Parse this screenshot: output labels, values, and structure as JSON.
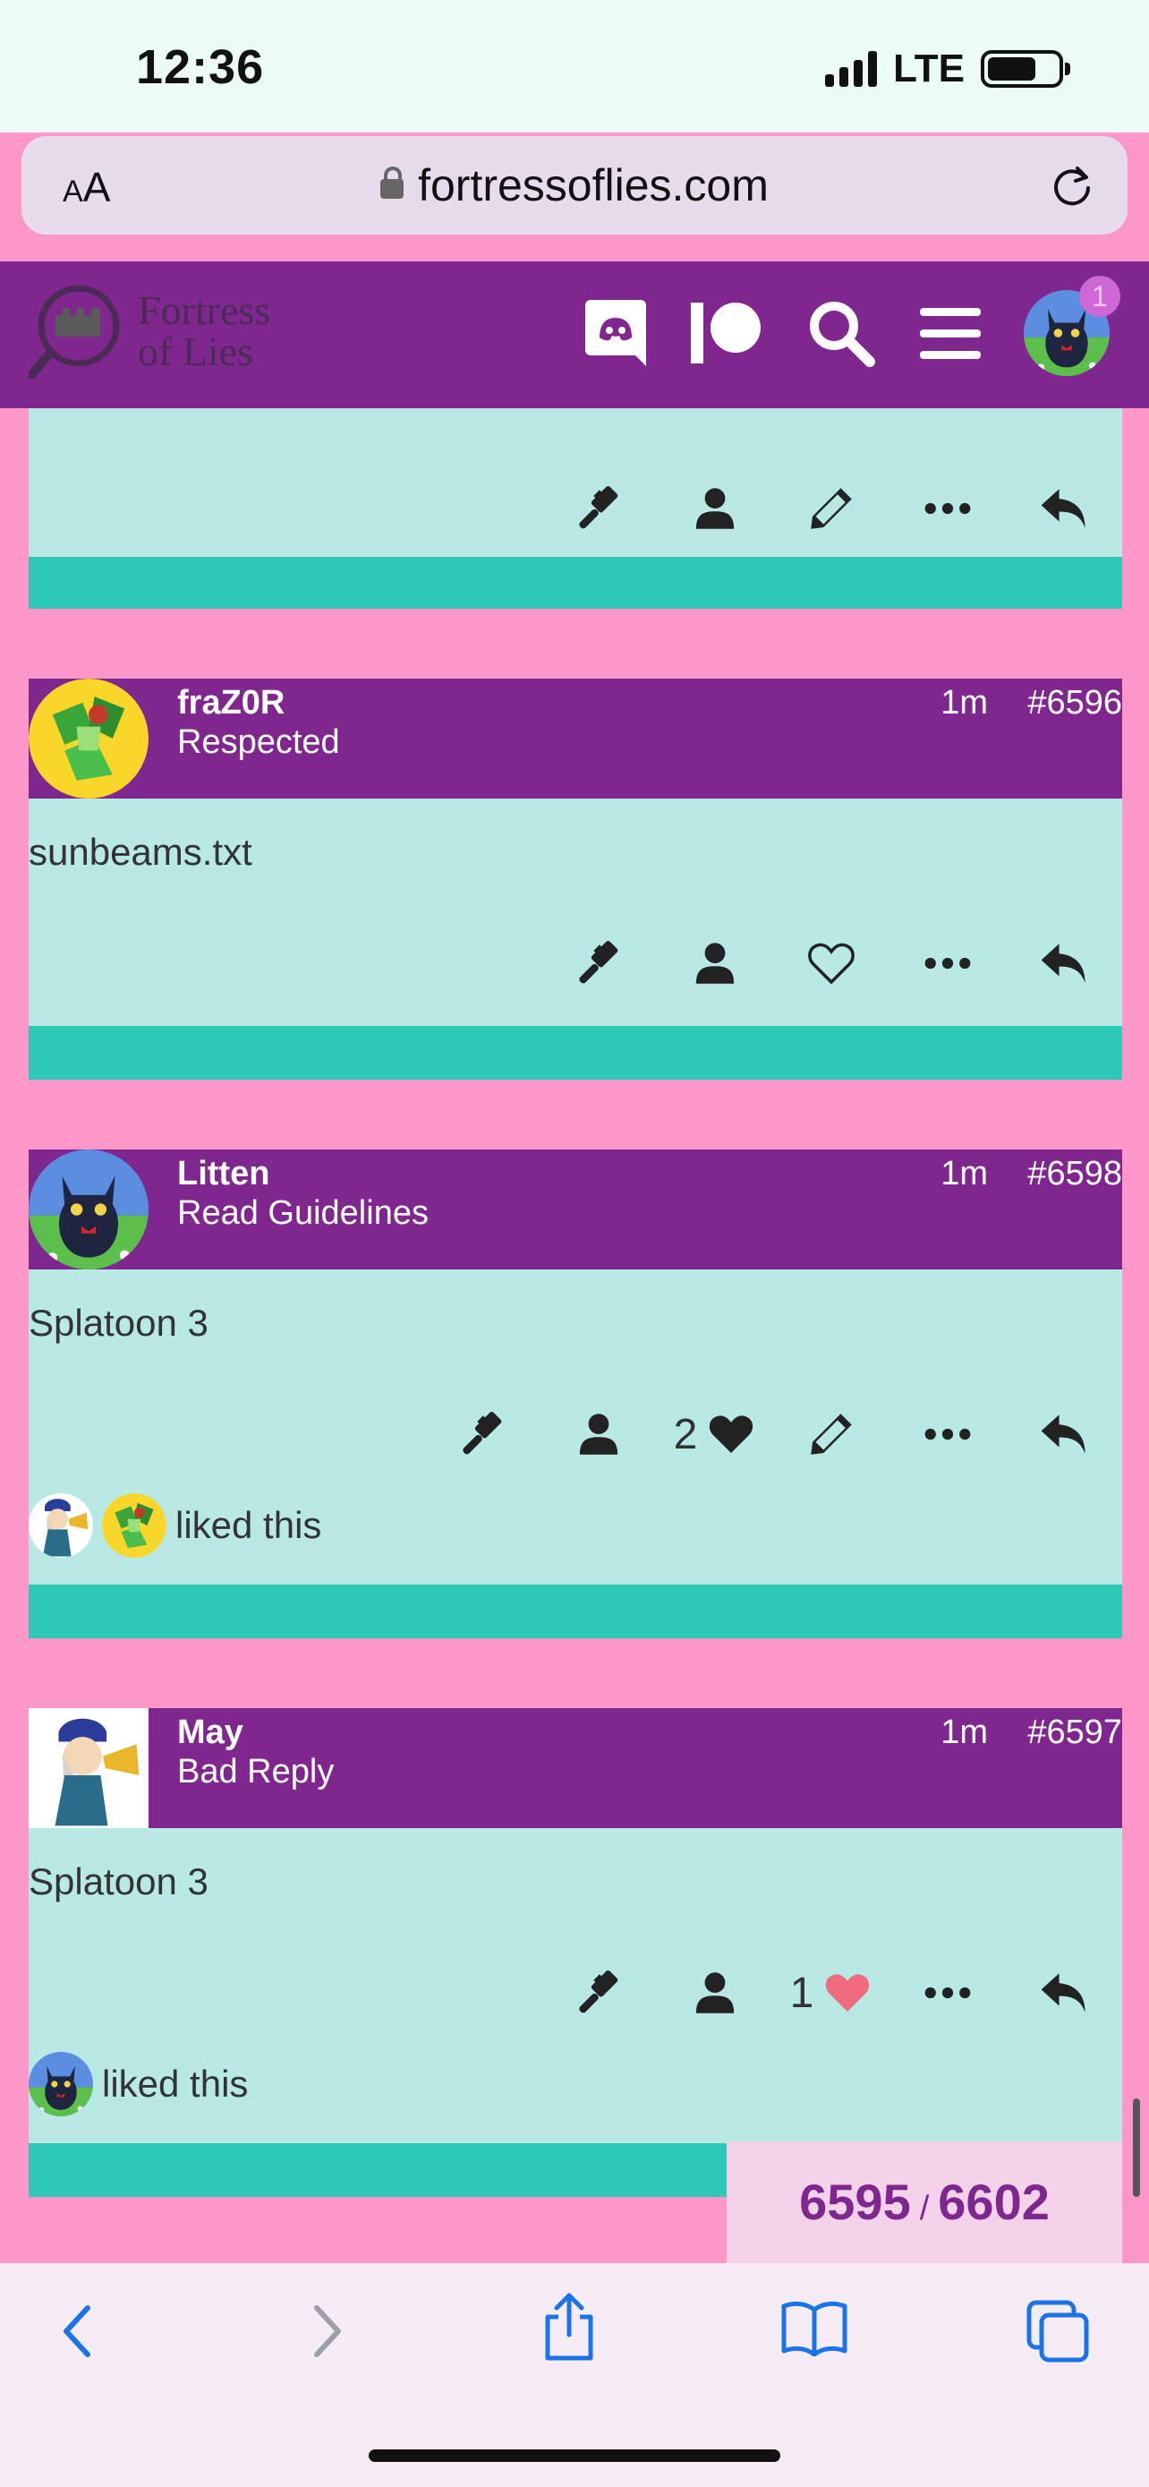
{
  "status_bar": {
    "time": "12:36",
    "network": "LTE"
  },
  "browser": {
    "font_control": "AA",
    "url": "fortressoflies.com"
  },
  "site": {
    "logo_line1": "Fortress",
    "logo_line2": "of Lies",
    "notification_count": "1",
    "icons": [
      "discord-icon",
      "patreon-icon",
      "search-icon",
      "menu-icon",
      "user-avatar"
    ]
  },
  "posts": [
    {
      "username": "fraZ0R",
      "rank": "Respected",
      "time": "1m",
      "number": "#6596",
      "text": "sunbeams.txt"
    },
    {
      "username": "Litten",
      "rank": "Read Guidelines",
      "time": "1m",
      "number": "#6598",
      "text": "Splatoon 3",
      "like_count": "2",
      "liked_label": "liked this"
    },
    {
      "username": "May",
      "rank": "Bad Reply",
      "time": "1m",
      "number": "#6597",
      "text": "Splatoon 3",
      "like_count": "1",
      "liked_label": "liked this"
    }
  ],
  "progress": {
    "current": "6595",
    "separator": "/",
    "total": "6602"
  },
  "colors": {
    "page_bg": "#fd97c9",
    "header_purple": "#7f278e",
    "post_body": "#b9e9e4",
    "post_footer": "#2ec9b6",
    "like_active": "#f16a7d",
    "ios_blue": "#1a73e8"
  }
}
